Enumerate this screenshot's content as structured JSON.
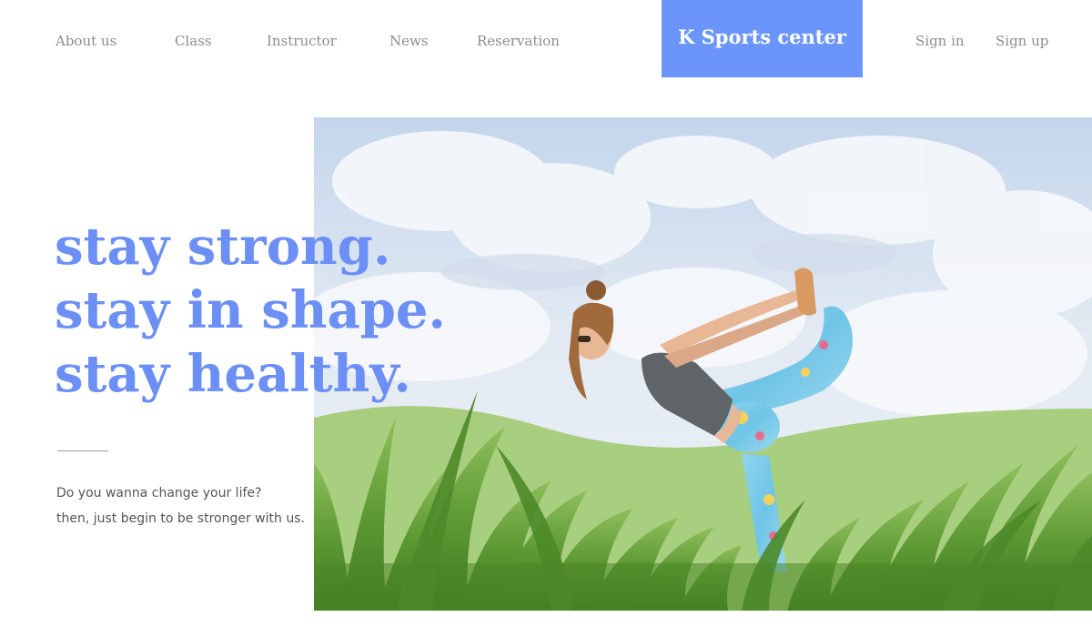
{
  "nav": {
    "about_us": "About us",
    "class": "Class",
    "instructor": "Instructor",
    "news": "News",
    "reservation": "Reservation",
    "sign_in": "Sign in",
    "sign_up": "Sign up"
  },
  "brand": {
    "name": "K Sports center",
    "color": "#6b95fb"
  },
  "hero": {
    "headline": [
      "stay strong.",
      "stay in shape.",
      "stay healthy."
    ],
    "headline_color": "#6b8ff5",
    "tagline": [
      "Do you wanna change your life?",
      "then, just begin to be stronger with us."
    ],
    "photo": "woman-stretching-in-grass-photo"
  }
}
